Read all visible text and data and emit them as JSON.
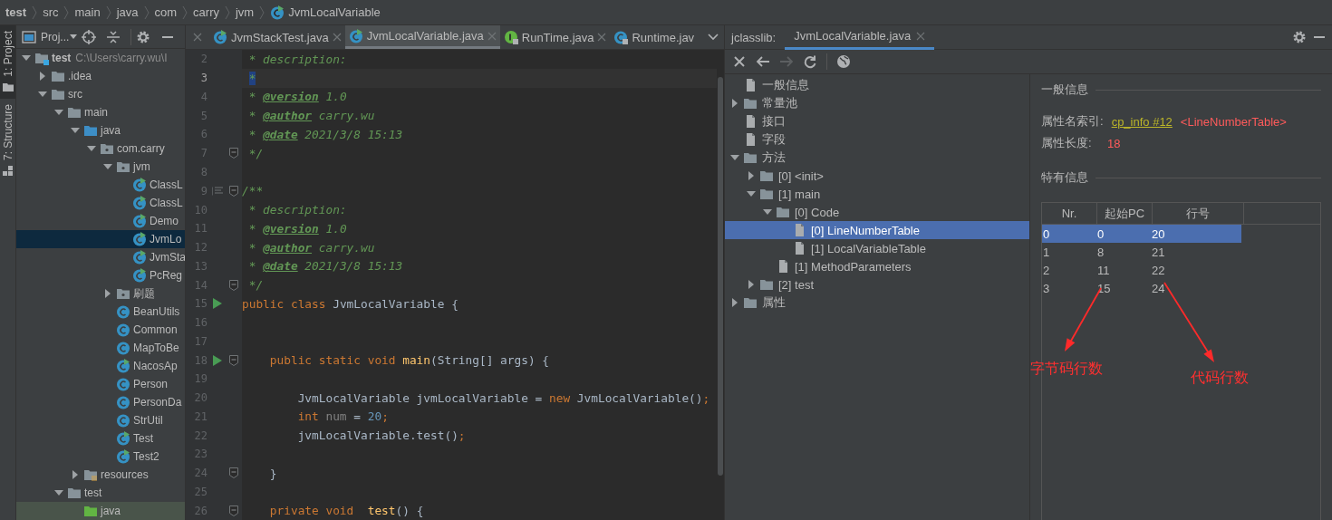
{
  "breadcrumb": [
    {
      "label": "test",
      "kind": "project"
    },
    {
      "label": "src",
      "kind": "folder"
    },
    {
      "label": "main",
      "kind": "folder"
    },
    {
      "label": "java",
      "kind": "folder"
    },
    {
      "label": "com",
      "kind": "folder"
    },
    {
      "label": "carry",
      "kind": "folder"
    },
    {
      "label": "jvm",
      "kind": "folder"
    },
    {
      "label": "JvmLocalVariable",
      "kind": "class"
    }
  ],
  "side_tabs": [
    {
      "label": "1: Project",
      "kind": "project",
      "selected": true
    },
    {
      "label": "7: Structure",
      "kind": "structure",
      "selected": false
    }
  ],
  "project": {
    "title": "Proj...",
    "tree": [
      {
        "label": "test",
        "path": "C:\\Users\\carry.wu\\I",
        "kind": "module",
        "expanded": true,
        "selected": false,
        "children": [
          {
            "label": ".idea",
            "kind": "folder",
            "expanded": false,
            "selected": false
          },
          {
            "label": "src",
            "kind": "folder",
            "expanded": true,
            "selected": false,
            "children": [
              {
                "label": "main",
                "kind": "folder",
                "expanded": true,
                "selected": false,
                "children": [
                  {
                    "label": "java",
                    "kind": "source",
                    "expanded": true,
                    "selected": false,
                    "children": [
                      {
                        "label": "com.carry",
                        "kind": "package",
                        "expanded": true,
                        "selected": false,
                        "children": [
                          {
                            "label": "jvm",
                            "kind": "package",
                            "expanded": true,
                            "selected": false,
                            "children": [
                              {
                                "label": "ClassL",
                                "kind": "class",
                                "runnable": true,
                                "selected": false
                              },
                              {
                                "label": "ClassL",
                                "kind": "class",
                                "runnable": true,
                                "selected": false
                              },
                              {
                                "label": "Demo",
                                "kind": "class",
                                "runnable": true,
                                "selected": false
                              },
                              {
                                "label": "JvmLo",
                                "kind": "class",
                                "runnable": true,
                                "selected": true
                              },
                              {
                                "label": "JvmSta",
                                "kind": "class",
                                "runnable": true,
                                "selected": false
                              },
                              {
                                "label": "PcReg",
                                "kind": "class",
                                "runnable": true,
                                "selected": false
                              }
                            ]
                          },
                          {
                            "label": "刷题",
                            "kind": "package",
                            "expanded": false,
                            "selected": false
                          },
                          {
                            "label": "BeanUtils",
                            "kind": "class",
                            "runnable": false,
                            "selected": false
                          },
                          {
                            "label": "Common",
                            "kind": "class",
                            "runnable": false,
                            "selected": false
                          },
                          {
                            "label": "MapToBe",
                            "kind": "class",
                            "runnable": false,
                            "selected": false
                          },
                          {
                            "label": "NacosAp",
                            "kind": "class",
                            "runnable": true,
                            "selected": false
                          },
                          {
                            "label": "Person",
                            "kind": "class",
                            "runnable": false,
                            "selected": false
                          },
                          {
                            "label": "PersonDa",
                            "kind": "class",
                            "runnable": false,
                            "selected": false
                          },
                          {
                            "label": "StrUtil",
                            "kind": "class",
                            "runnable": false,
                            "selected": false
                          },
                          {
                            "label": "Test",
                            "kind": "class",
                            "runnable": true,
                            "selected": false
                          },
                          {
                            "label": "Test2",
                            "kind": "class",
                            "runnable": true,
                            "selected": false
                          }
                        ]
                      }
                    ]
                  },
                  {
                    "label": "resources",
                    "kind": "resources",
                    "expanded": false,
                    "selected": false
                  }
                ]
              },
              {
                "label": "test",
                "kind": "folder",
                "expanded": true,
                "selected": false,
                "children": [
                  {
                    "label": "java",
                    "kind": "test-root",
                    "selected": false
                  }
                ]
              }
            ]
          }
        ]
      }
    ]
  },
  "editor": {
    "tabs": [
      {
        "label": "JvmStackTest.java",
        "kind": "runnable-class",
        "selected": false,
        "closable": true
      },
      {
        "label": "JvmLocalVariable.java",
        "kind": "runnable-class",
        "selected": true,
        "closable": true
      },
      {
        "label": "RunTime.java",
        "kind": "library-interface",
        "selected": false,
        "closable": true
      },
      {
        "label": "Runtime.jav",
        "kind": "library-class",
        "selected": false,
        "closable": false
      }
    ],
    "lines": [
      {
        "number": "2",
        "run": false,
        "fold": false,
        "doc": false,
        "current": false,
        "tokens": [
          {
            "kind": "comment",
            "text": " * description:"
          }
        ]
      },
      {
        "number": "3",
        "run": false,
        "fold": false,
        "doc": false,
        "current": true,
        "tokens": [
          {
            "kind": "highlight",
            "text": "*"
          }
        ]
      },
      {
        "number": "4",
        "run": false,
        "fold": false,
        "doc": false,
        "current": false,
        "tokens": [
          {
            "kind": "comment",
            "text": " * "
          },
          {
            "kind": "tag",
            "text": "@version"
          },
          {
            "kind": "comment",
            "text": " 1.0"
          }
        ]
      },
      {
        "number": "5",
        "run": false,
        "fold": false,
        "doc": false,
        "current": false,
        "tokens": [
          {
            "kind": "comment",
            "text": " * "
          },
          {
            "kind": "tag",
            "text": "@author"
          },
          {
            "kind": "comment",
            "text": " carry.wu"
          }
        ]
      },
      {
        "number": "6",
        "run": false,
        "fold": false,
        "doc": false,
        "current": false,
        "tokens": [
          {
            "kind": "comment",
            "text": " * "
          },
          {
            "kind": "tag",
            "text": "@date"
          },
          {
            "kind": "comment",
            "text": " 2021/3/8 15:13"
          }
        ]
      },
      {
        "number": "7",
        "run": false,
        "fold": true,
        "doc": false,
        "current": false,
        "tokens": [
          {
            "kind": "comment",
            "text": " */"
          }
        ]
      },
      {
        "number": "8",
        "run": false,
        "fold": false,
        "doc": false,
        "current": false
      },
      {
        "number": "9",
        "run": false,
        "fold": true,
        "doc": true,
        "current": false,
        "tokens": [
          {
            "kind": "comment",
            "text": "/**"
          }
        ]
      },
      {
        "number": "10",
        "run": false,
        "fold": false,
        "doc": false,
        "current": false,
        "tokens": [
          {
            "kind": "comment",
            "text": " * description:"
          }
        ]
      },
      {
        "number": "11",
        "run": false,
        "fold": false,
        "doc": false,
        "current": false,
        "tokens": [
          {
            "kind": "comment",
            "text": " * "
          },
          {
            "kind": "tag",
            "text": "@version"
          },
          {
            "kind": "comment",
            "text": " 1.0"
          }
        ]
      },
      {
        "number": "12",
        "run": false,
        "fold": false,
        "doc": false,
        "current": false,
        "tokens": [
          {
            "kind": "comment",
            "text": " * "
          },
          {
            "kind": "tag",
            "text": "@author"
          },
          {
            "kind": "comment",
            "text": " carry.wu"
          }
        ]
      },
      {
        "number": "13",
        "run": false,
        "fold": false,
        "doc": false,
        "current": false,
        "tokens": [
          {
            "kind": "comment",
            "text": " * "
          },
          {
            "kind": "tag",
            "text": "@date"
          },
          {
            "kind": "comment",
            "text": " 2021/3/8 15:13"
          }
        ]
      },
      {
        "number": "14",
        "run": false,
        "fold": true,
        "doc": false,
        "current": false,
        "tokens": [
          {
            "kind": "comment",
            "text": " */"
          }
        ]
      },
      {
        "number": "15",
        "run": true,
        "fold": false,
        "doc": false,
        "current": false,
        "tokens": [
          {
            "kind": "keyword",
            "text": "public class "
          },
          {
            "kind": "plain",
            "text": "JvmLocalVariable {"
          }
        ]
      },
      {
        "number": "16",
        "run": false,
        "fold": false,
        "doc": false,
        "current": false
      },
      {
        "number": "17",
        "run": false,
        "fold": false,
        "doc": false,
        "current": false
      },
      {
        "number": "18",
        "run": true,
        "fold": true,
        "doc": false,
        "current": false,
        "tokens": [
          {
            "kind": "keyword",
            "text": "    public static void "
          },
          {
            "kind": "method",
            "text": "main"
          },
          {
            "kind": "plain",
            "text": "(String[] args) {"
          }
        ]
      },
      {
        "number": "19",
        "run": false,
        "fold": false,
        "doc": false,
        "current": false
      },
      {
        "number": "20",
        "run": false,
        "fold": false,
        "doc": false,
        "current": false,
        "tokens": [
          {
            "kind": "plain",
            "text": "        JvmLocalVariable jvmLocalVariable = "
          },
          {
            "kind": "keyword",
            "text": "new "
          },
          {
            "kind": "plain",
            "text": "JvmLocalVariable()"
          },
          {
            "kind": "keyword",
            "text": ";"
          }
        ]
      },
      {
        "number": "21",
        "run": false,
        "fold": false,
        "doc": false,
        "current": false,
        "tokens": [
          {
            "kind": "keyword",
            "text": "        int "
          },
          {
            "kind": "unused",
            "text": "num"
          },
          {
            "kind": "plain",
            "text": " = "
          },
          {
            "kind": "number",
            "text": "20"
          },
          {
            "kind": "keyword",
            "text": ";"
          }
        ]
      },
      {
        "number": "22",
        "run": false,
        "fold": false,
        "doc": false,
        "current": false,
        "tokens": [
          {
            "kind": "plain",
            "text": "        jvmLocalVariable.test()"
          },
          {
            "kind": "keyword",
            "text": ";"
          }
        ]
      },
      {
        "number": "23",
        "run": false,
        "fold": false,
        "doc": false,
        "current": false
      },
      {
        "number": "24",
        "run": false,
        "fold": true,
        "doc": false,
        "current": false,
        "tokens": [
          {
            "kind": "plain",
            "text": "    }"
          }
        ]
      },
      {
        "number": "25",
        "run": false,
        "fold": false,
        "doc": false,
        "current": false
      },
      {
        "number": "26",
        "run": false,
        "fold": true,
        "doc": false,
        "current": false,
        "tokens": [
          {
            "kind": "keyword",
            "text": "    private void  "
          },
          {
            "kind": "method",
            "text": "test"
          },
          {
            "kind": "plain",
            "text": "() {"
          }
        ]
      }
    ]
  },
  "classlib": {
    "label": "jclasslib:",
    "tabs": [
      {
        "label": "JvmLocalVariable.java",
        "selected": true
      }
    ],
    "toolbar": [
      {
        "kind": "close",
        "disabled": false
      },
      {
        "kind": "back",
        "disabled": false
      },
      {
        "kind": "forward",
        "disabled": true
      },
      {
        "kind": "refresh",
        "disabled": false
      },
      {
        "kind": "web",
        "disabled": false
      }
    ],
    "tree": [
      {
        "label": "一般信息",
        "kind": "file",
        "selected": false
      },
      {
        "label": "常量池",
        "kind": "folder",
        "expanded": false,
        "selected": false
      },
      {
        "label": "接口",
        "kind": "file",
        "selected": false
      },
      {
        "label": "字段",
        "kind": "file",
        "selected": false
      },
      {
        "label": "方法",
        "kind": "folder",
        "expanded": true,
        "selected": false,
        "children": [
          {
            "label": "[0] <init>",
            "kind": "folder",
            "expanded": false,
            "selected": false
          },
          {
            "label": "[1] main",
            "kind": "folder",
            "expanded": true,
            "selected": false,
            "children": [
              {
                "label": "[0] Code",
                "kind": "folder",
                "expanded": true,
                "selected": false,
                "children": [
                  {
                    "label": "[0] LineNumberTable",
                    "kind": "file",
                    "selected": true
                  },
                  {
                    "label": "[1] LocalVariableTable",
                    "kind": "file",
                    "selected": false
                  }
                ]
              },
              {
                "label": "[1] MethodParameters",
                "kind": "file",
                "selected": false
              }
            ]
          },
          {
            "label": "[2] test",
            "kind": "folder",
            "expanded": false,
            "selected": false
          }
        ]
      },
      {
        "label": "属性",
        "kind": "folder",
        "expanded": false,
        "selected": false
      }
    ],
    "details": {
      "general_title": "一般信息",
      "fields": [
        {
          "label": "属性名索引:",
          "link": "cp_info #12",
          "value": "<LineNumberTable>"
        },
        {
          "label": "属性长度:",
          "value": "18"
        }
      ],
      "specific_title": "特有信息",
      "table": {
        "columns": [
          "Nr.",
          "起始PC",
          "行号"
        ],
        "rows": [
          {
            "cells": [
              "0",
              "0",
              "20"
            ],
            "selected": true
          },
          {
            "cells": [
              "1",
              "8",
              "21"
            ],
            "selected": false
          },
          {
            "cells": [
              "2",
              "11",
              "22"
            ],
            "selected": false
          },
          {
            "cells": [
              "3",
              "15",
              "24"
            ],
            "selected": false
          }
        ]
      }
    },
    "annotations": [
      {
        "label": "字节码行数"
      },
      {
        "label": "代码行数"
      }
    ]
  }
}
